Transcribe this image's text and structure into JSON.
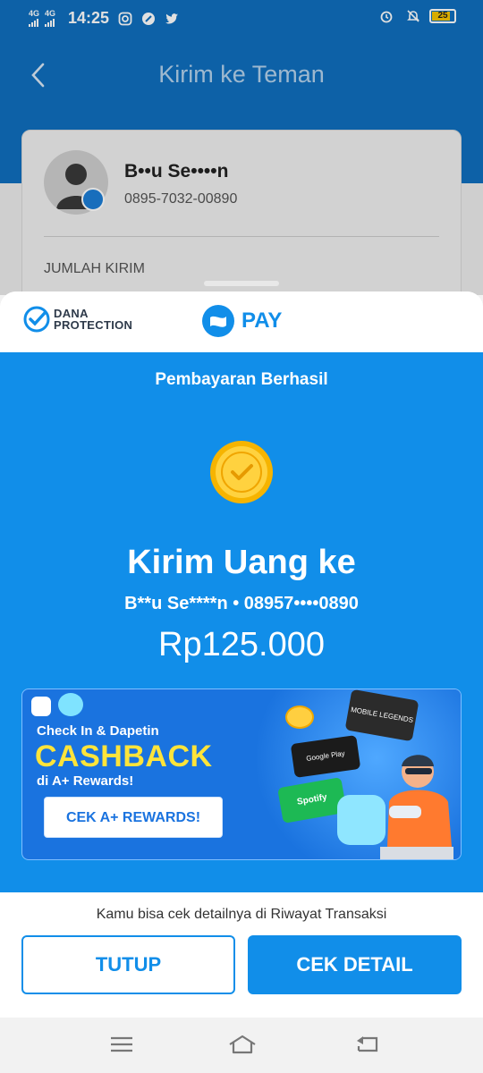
{
  "status_bar": {
    "network1": "4G",
    "network2": "4G",
    "time": "14:25",
    "battery": "25"
  },
  "background_screen": {
    "title": "Kirim ke Teman",
    "contact_name": "B••u Se••••n",
    "contact_phone": "0895-7032-00890",
    "amount_label": "JUMLAH KIRIM"
  },
  "sheet": {
    "protection_line1": "DANA",
    "protection_line2": "PROTECTION",
    "pay_label": "PAY",
    "success_title": "Pembayaran Berhasil",
    "send_title": "Kirim Uang ke",
    "recipient": "B**u Se****n • 08957••••0890",
    "amount": "Rp125.000"
  },
  "banner": {
    "line1": "Check In & Dapetin",
    "headline": "CASHBACK",
    "line2": "di A+ Rewards!",
    "button": "CEK A+ REWARDS!",
    "tile_mlbb": "MOBILE LEGENDS",
    "tile_gplay": "Google Play",
    "tile_spotify": "Spotify"
  },
  "footer": {
    "hint": "Kamu bisa cek detailnya di Riwayat Transaksi",
    "close_button": "TUTUP",
    "detail_button": "CEK DETAIL"
  },
  "colors": {
    "primary": "#118ee9",
    "header_blue": "#0f6fbf",
    "cashback_yellow": "#ffe43a"
  }
}
